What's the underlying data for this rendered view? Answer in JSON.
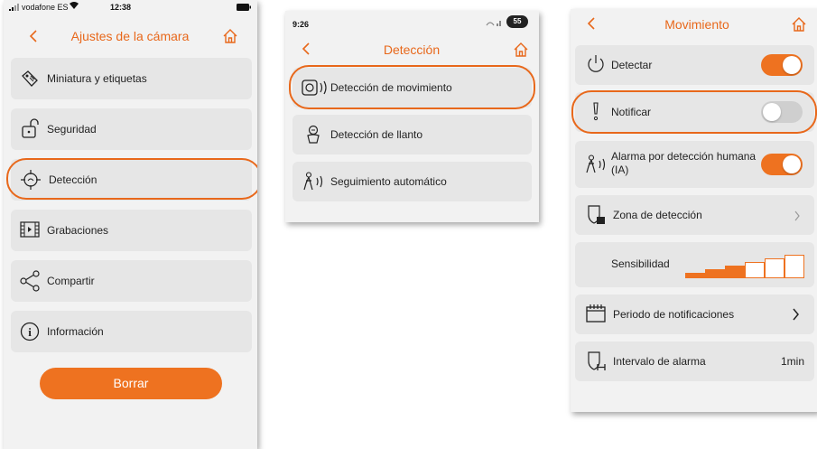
{
  "accent_color": "#e8681b",
  "phone1": {
    "status": {
      "carrier": "vodafone ES",
      "time": "12:38"
    },
    "title": "Ajustes de la cámara",
    "items": [
      {
        "label": "Miniatura y etiquetas",
        "icon": "tag-icon"
      },
      {
        "label": "Seguridad",
        "icon": "unlock-icon"
      },
      {
        "label": "Detección",
        "icon": "crosshair-icon",
        "highlighted": true
      },
      {
        "label": "Grabaciones",
        "icon": "film-icon"
      },
      {
        "label": "Compartir",
        "icon": "share-icon"
      },
      {
        "label": "Información",
        "icon": "info-icon"
      }
    ],
    "delete_button": "Borrar"
  },
  "phone2": {
    "status": {
      "time": "9:26",
      "battery": "55"
    },
    "title": "Detección",
    "items": [
      {
        "label": "Detección de movimiento",
        "icon": "motion-sensor-icon",
        "highlighted": true
      },
      {
        "label": "Detección de llanto",
        "icon": "crying-baby-icon"
      },
      {
        "label": "Seguimiento automático",
        "icon": "person-tracking-icon"
      }
    ]
  },
  "phone3": {
    "title": "Movimiento",
    "rows": {
      "detect": {
        "label": "Detectar",
        "toggle": true
      },
      "notify": {
        "label": "Notificar",
        "toggle": false,
        "highlighted": true
      },
      "human_alarm": {
        "label_line1": "Alarma por detección humana",
        "label_line2": "(IA)",
        "toggle": true
      },
      "zone": {
        "label": "Zona de detección"
      },
      "sensitivity": {
        "label": "Sensibilidad",
        "level": 3,
        "max_level": 6
      },
      "period": {
        "label": "Periodo de notificaciones"
      },
      "interval": {
        "label": "Intervalo de alarma",
        "value": "1min"
      }
    }
  }
}
